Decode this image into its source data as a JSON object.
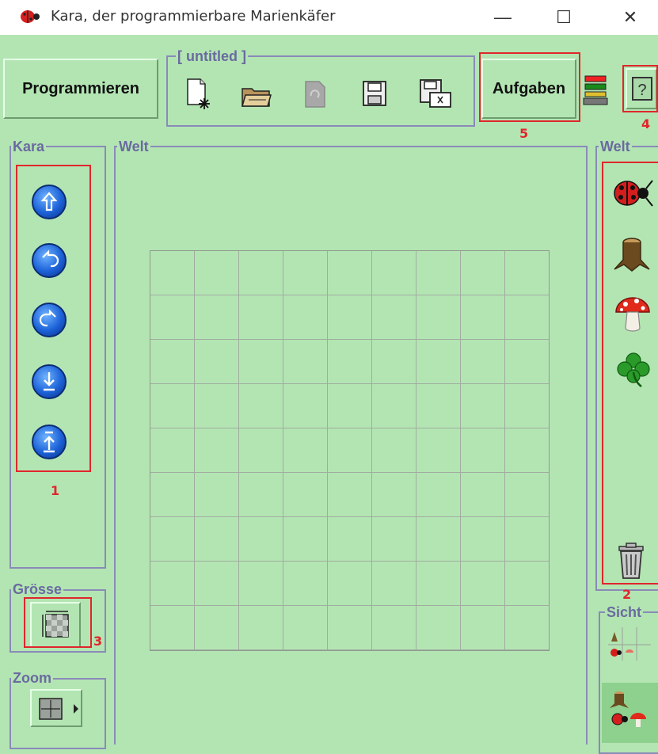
{
  "window": {
    "title": "Kara, der programmierbare Marienkäfer",
    "minimize_glyph": "—",
    "maximize_glyph": "☐",
    "close_glyph": "✕"
  },
  "toolbar": {
    "program_label": "Programmieren",
    "file_group_title": "[ untitled ]",
    "tasks_label": "Aufgaben",
    "file_icons": [
      "new-file-icon",
      "open-folder-icon",
      "reload-icon",
      "save-icon",
      "save-as-icon"
    ],
    "tools_icon": "tools-icon",
    "help_icon": "help-icon"
  },
  "panels": {
    "kara_title": "Kara",
    "welt_title": "Welt",
    "welt_palette_title": "Welt",
    "groesse_title": "Grösse",
    "zoom_title": "Zoom",
    "sicht_title": "Sicht"
  },
  "kara_controls": [
    "move-forward-icon",
    "turn-left-icon",
    "turn-right-icon",
    "put-leaf-icon",
    "pick-leaf-icon"
  ],
  "world_palette": [
    "ladybug-icon",
    "tree-stump-icon",
    "mushroom-icon",
    "clover-leaf-icon",
    "trash-icon"
  ],
  "world_grid": {
    "columns": 9,
    "rows": 9
  },
  "annotations": {
    "kara_controls": "1",
    "world_palette": "2",
    "groesse": "3",
    "help": "4",
    "aufgaben": "5"
  },
  "colors": {
    "background": "#b3e5b3",
    "highlight_box": "#e0262c",
    "panel_title": "#6a6aa0"
  }
}
